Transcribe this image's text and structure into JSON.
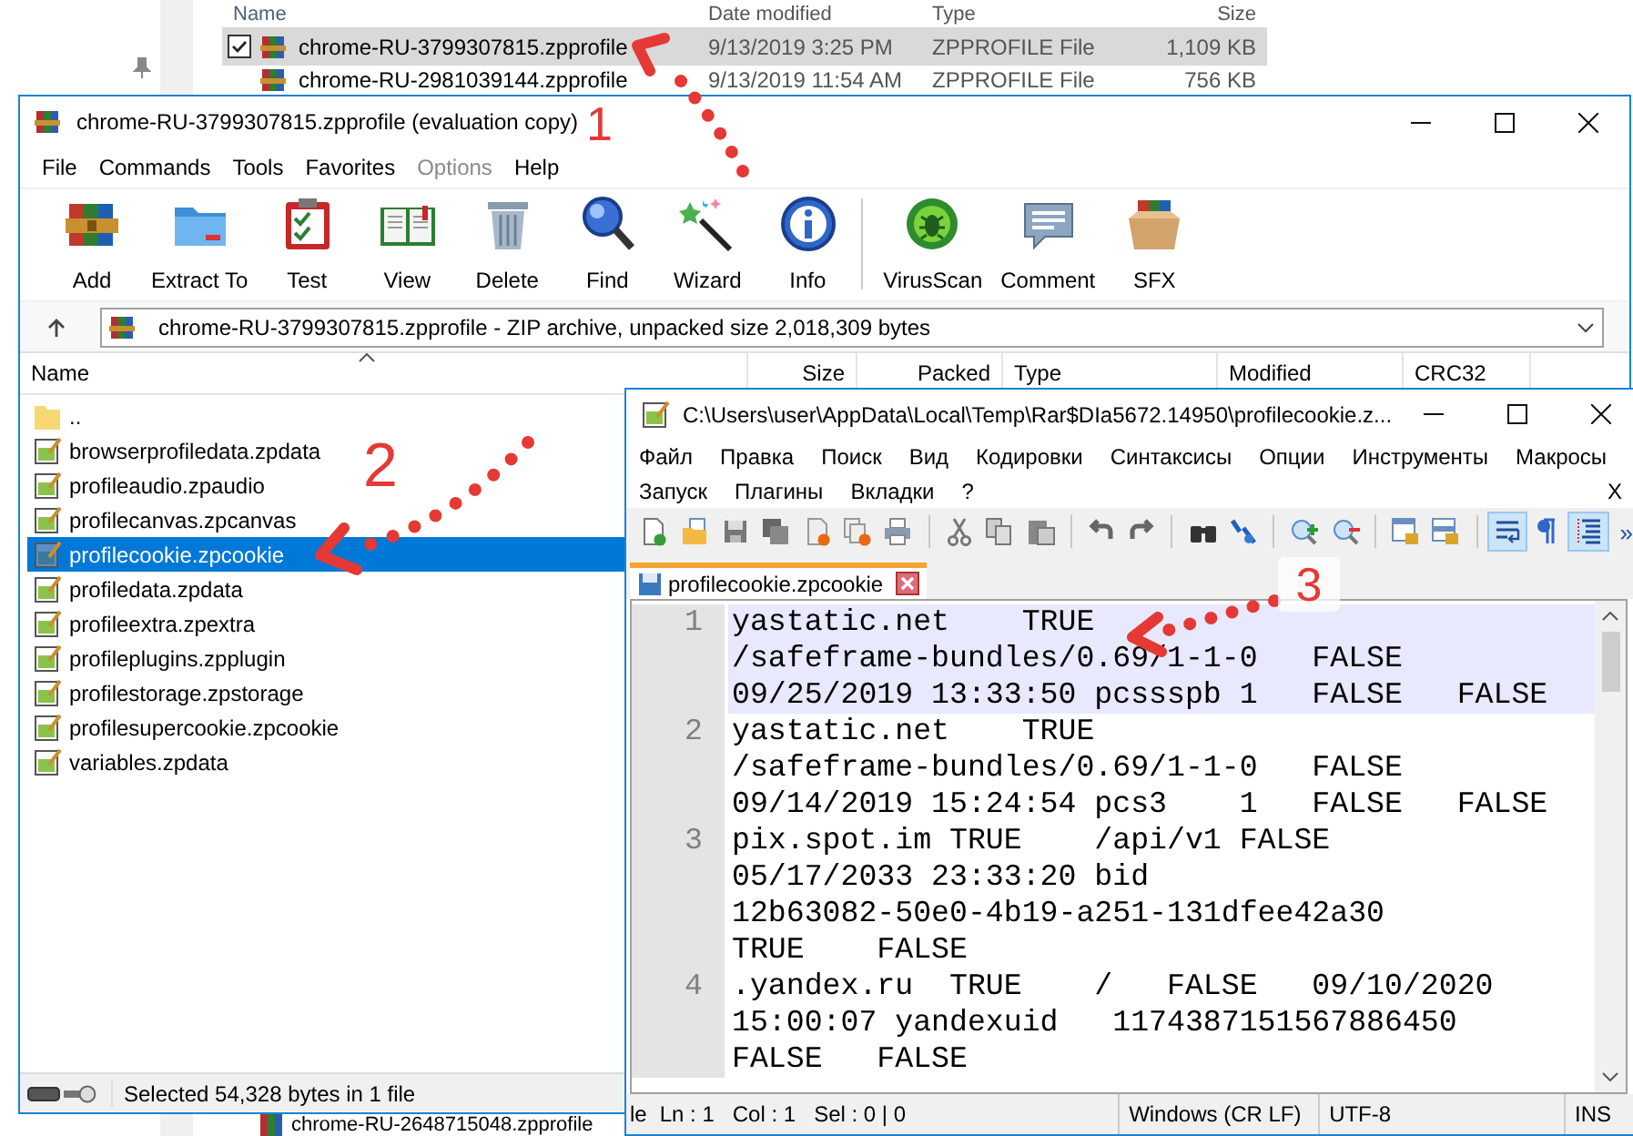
{
  "explorer": {
    "columns": [
      "Name",
      "Date modified",
      "Type",
      "Size"
    ],
    "rows": [
      {
        "name": "chrome-RU-3799307815.zpprofile",
        "date": "9/13/2019 3:25 PM",
        "type": "ZPPROFILE File",
        "size": "1,109 KB",
        "selected": true,
        "checked": true
      },
      {
        "name": "chrome-RU-2981039144.zpprofile",
        "date": "9/13/2019 11:54 AM",
        "type": "ZPPROFILE File",
        "size": "756 KB",
        "selected": false,
        "checked": false
      }
    ],
    "bottom_row": {
      "name": "chrome-RU-2648715048.zpprofile"
    }
  },
  "archiver": {
    "title": "chrome-RU-3799307815.zpprofile (evaluation copy)",
    "menu": [
      "File",
      "Commands",
      "Tools",
      "Favorites",
      "Options",
      "Help"
    ],
    "toolbar": [
      [
        "Add",
        "Extract To",
        "Test",
        "View",
        "Delete",
        "Find",
        "Wizard",
        "Info"
      ],
      [
        "VirusScan",
        "Comment",
        "SFX"
      ]
    ],
    "address": "chrome-RU-3799307815.zpprofile - ZIP archive, unpacked size 2,018,309 bytes",
    "columns": [
      "Name",
      "Size",
      "Packed",
      "Type",
      "Modified",
      "CRC32"
    ],
    "files": [
      {
        "name": "..",
        "kind": "folder",
        "selected": false
      },
      {
        "name": "browserprofiledata.zpdata",
        "kind": "file",
        "selected": false
      },
      {
        "name": "profileaudio.zpaudio",
        "kind": "file",
        "selected": false
      },
      {
        "name": "profilecanvas.zpcanvas",
        "kind": "file",
        "selected": false
      },
      {
        "name": "profilecookie.zpcookie",
        "kind": "file",
        "selected": true
      },
      {
        "name": "profiledata.zpdata",
        "kind": "file",
        "selected": false
      },
      {
        "name": "profileextra.zpextra",
        "kind": "file",
        "selected": false
      },
      {
        "name": "profileplugins.zpplugin",
        "kind": "file",
        "selected": false
      },
      {
        "name": "profilestorage.zpstorage",
        "kind": "file",
        "selected": false
      },
      {
        "name": "profilesupercookie.zpcookie",
        "kind": "file",
        "selected": false
      },
      {
        "name": "variables.zpdata",
        "kind": "file",
        "selected": false
      }
    ],
    "status": "Selected 54,328 bytes in 1 file"
  },
  "editor": {
    "title": "C:\\Users\\user\\AppData\\Local\\Temp\\Rar$DIa5672.14950\\profilecookie.z...",
    "menu_rows": [
      [
        "Файл",
        "Правка",
        "Поиск",
        "Вид",
        "Кодировки",
        "Синтаксисы",
        "Опции",
        "Инструменты",
        "Макросы"
      ],
      [
        "Запуск",
        "Плагины",
        "Вкладки",
        "?"
      ]
    ],
    "menu_close": "X",
    "toolbar": [
      [
        {
          "on": false
        },
        {
          "on": false
        },
        {
          "on": false
        },
        {
          "on": false
        },
        {
          "on": false
        },
        {
          "on": false
        },
        {
          "on": false
        }
      ],
      [
        {
          "on": false
        },
        {
          "on": false
        },
        {
          "on": false
        }
      ],
      [
        {
          "on": false
        },
        {
          "on": false
        }
      ],
      [
        {
          "on": false
        },
        {
          "on": false
        }
      ],
      [
        {
          "on": false
        },
        {
          "on": false
        }
      ],
      [
        {
          "on": false
        },
        {
          "on": false
        }
      ],
      [
        {
          "on": true
        },
        {
          "on": false
        },
        {
          "on": true
        }
      ]
    ],
    "toolbar_more": "»",
    "tabs": [
      {
        "label": "profilecookie.zpcookie",
        "selected": true
      }
    ],
    "lines": [
      {
        "number": "1",
        "current": true,
        "rows": [
          "yastatic.net    TRUE",
          "/safeframe-bundles/0.69/1-1-0   FALSE",
          "09/25/2019 13:33:50 pcssspb 1   FALSE   FALSE"
        ]
      },
      {
        "number": "2",
        "current": false,
        "rows": [
          "yastatic.net    TRUE",
          "/safeframe-bundles/0.69/1-1-0   FALSE",
          "09/14/2019 15:24:54 pcs3    1   FALSE   FALSE"
        ]
      },
      {
        "number": "3",
        "current": false,
        "rows": [
          "pix.spot.im TRUE    /api/v1 FALSE",
          "05/17/2033 23:33:20 bid",
          "12b63082-50e0-4b19-a251-131dfee42a30",
          "TRUE    FALSE"
        ]
      },
      {
        "number": "4",
        "current": false,
        "rows": [
          ".yandex.ru  TRUE    /   FALSE   09/10/2020",
          "15:00:07 yandexuid   1174387151567886450",
          "FALSE   FALSE"
        ]
      }
    ],
    "status": [
      "le",
      "Ln : 1",
      "Col : 1",
      "Sel : 0 | 0",
      "Windows (CR LF)",
      "UTF-8",
      "INS"
    ]
  },
  "annotations": [
    {
      "label": "1"
    },
    {
      "label": "2"
    },
    {
      "label": "3"
    }
  ]
}
